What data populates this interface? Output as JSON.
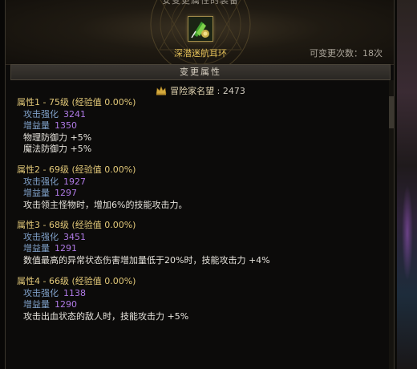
{
  "window": {
    "title": "安变更属性的装备"
  },
  "item": {
    "icon": "earring-icon",
    "name": "深潜迷航耳环",
    "change_count_text": "可变更次数：18次"
  },
  "section": {
    "label": "变更属性"
  },
  "reputation": {
    "icon": "crown-icon",
    "label": "冒险家名望",
    "value": ": 2473"
  },
  "attributes": [
    {
      "title": "属性1 - 75级 (经验值 0.00%)",
      "stats": [
        {
          "label": "攻击强化",
          "value": "3241"
        },
        {
          "label": "增益量",
          "value": "1350"
        }
      ],
      "effects": [
        "物理防御力 +5%",
        "魔法防御力 +5%"
      ]
    },
    {
      "title": "属性2 - 69级 (经验值 0.00%)",
      "stats": [
        {
          "label": "攻击强化",
          "value": "1927"
        },
        {
          "label": "增益量",
          "value": "1297"
        }
      ],
      "effects": [
        "攻击领主怪物时，增加6%的技能攻击力。"
      ]
    },
    {
      "title": "属性3 - 68级 (经验值 0.00%)",
      "stats": [
        {
          "label": "攻击强化",
          "value": "3451"
        },
        {
          "label": "增益量",
          "value": "1291"
        }
      ],
      "effects": [
        "数值最高的异常状态伤害增加量低于20%时，技能攻击力 +4%"
      ]
    },
    {
      "title": "属性4 - 66级 (经验值 0.00%)",
      "stats": [
        {
          "label": "攻击强化",
          "value": "1138"
        },
        {
          "label": "增益量",
          "value": "1290"
        }
      ],
      "effects": [
        "攻击出血状态的敌人时，技能攻击力 +5%"
      ]
    }
  ],
  "colors": {
    "background": "#0c0b0a",
    "title_gold": "#e3c979",
    "item_name_gold": "#e6c25a",
    "stat_label_blue": "#7fa0c8",
    "stat_value_purple": "#b07ae6",
    "effect_text": "#e6e3dc"
  }
}
